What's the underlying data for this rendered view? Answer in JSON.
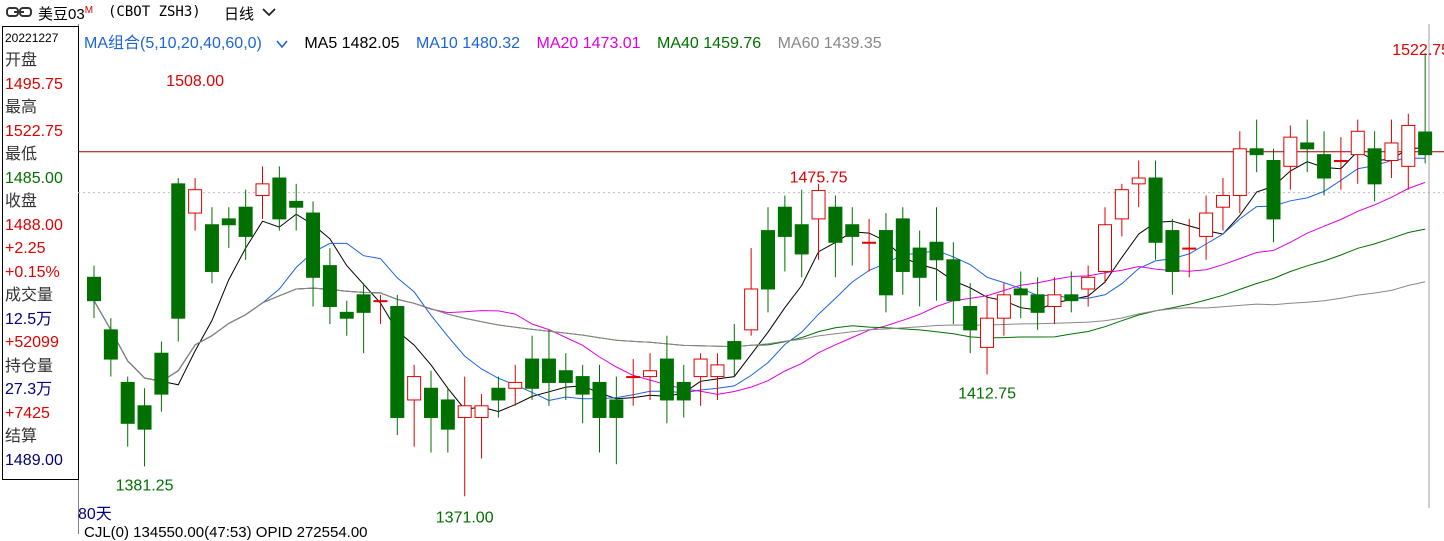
{
  "header": {
    "symbol": "美豆03",
    "symbol_mark": "M",
    "exchange": "(CBOT ZSH3)",
    "period": "日线",
    "link_icon": "link-icon",
    "chevron_icon": "chevron-down-icon"
  },
  "info_panel": {
    "date": "20221227",
    "open_label": "开盘",
    "open": "1495.75",
    "high_label": "最高",
    "high": "1522.75",
    "low_label": "最低",
    "low": "1485.00",
    "close_label": "收盘",
    "close": "1488.00",
    "change": "+2.25",
    "change_pct": "+0.15%",
    "volume_label": "成交量",
    "volume": "12.5万",
    "volume_change": "+52099",
    "oi_label": "持仓量",
    "oi": "27.3万",
    "oi_change": "+7425",
    "settle_label": "结算",
    "settle": "1489.00"
  },
  "legend": {
    "ma_combo": "MA组合(5,10,20,40,60,0)",
    "ma5": "MA5 1482.05",
    "ma10": "MA10 1480.32",
    "ma20": "MA20 1473.01",
    "ma40": "MA40 1459.76",
    "ma60": "MA60 1439.35"
  },
  "day_count": "80天",
  "bottom_text": "CJL(0)    134550.00(47:53)  OPID 272554.00",
  "colors": {
    "up": "#e00000",
    "down": "#007000",
    "ma5": "#000000",
    "ma10": "#1e64d8",
    "ma20": "#e000e0",
    "ma40": "#007000",
    "ma60": "#888888",
    "ref_line": "#a00000"
  },
  "chart_data": {
    "type": "candlestick",
    "y_range": [
      1367,
      1530
    ],
    "reference_price": 1489.0,
    "annotations": {
      "high_1508": "1508.00",
      "low_1381": "1381.25",
      "low_1371": "1371.00",
      "high_1475": "1475.75",
      "low_1412": "1412.75",
      "last_high": "1522.75"
    },
    "candles": [
      [
        1446,
        1438,
        1450,
        1432
      ],
      [
        1428,
        1418,
        1432,
        1412
      ],
      [
        1410,
        1396,
        1412,
        1388
      ],
      [
        1402,
        1394,
        1408,
        1381.25
      ],
      [
        1420,
        1406,
        1424,
        1400
      ],
      [
        1478,
        1432,
        1480,
        1424
      ],
      [
        1468,
        1476,
        1480,
        1462
      ],
      [
        1464,
        1448,
        1470,
        1444
      ],
      [
        1466,
        1464,
        1470,
        1456
      ],
      [
        1470,
        1460,
        1476,
        1452
      ],
      [
        1474,
        1478,
        1484,
        1466
      ],
      [
        1480,
        1466,
        1484,
        1462
      ],
      [
        1472,
        1470,
        1478,
        1462
      ],
      [
        1468,
        1446,
        1472,
        1436
      ],
      [
        1450,
        1436,
        1456,
        1430
      ],
      [
        1434,
        1432,
        1438,
        1426
      ],
      [
        1440,
        1434,
        1444,
        1420
      ],
      [
        1438,
        1438,
        1440,
        1430
      ],
      [
        1436,
        1398,
        1440,
        1392
      ],
      [
        1404,
        1412,
        1416,
        1388
      ],
      [
        1408,
        1398,
        1414,
        1386
      ],
      [
        1404,
        1394,
        1408,
        1386
      ],
      [
        1398,
        1402,
        1412,
        1371
      ],
      [
        1398,
        1402,
        1406,
        1384
      ],
      [
        1408,
        1404,
        1412,
        1398
      ],
      [
        1408,
        1410,
        1416,
        1402
      ],
      [
        1418,
        1408,
        1426,
        1404
      ],
      [
        1418,
        1410,
        1428,
        1402
      ],
      [
        1414,
        1410,
        1420,
        1404
      ],
      [
        1412,
        1406,
        1416,
        1396
      ],
      [
        1410,
        1398,
        1416,
        1386
      ],
      [
        1404,
        1398,
        1412,
        1382
      ],
      [
        1412,
        1412,
        1418,
        1402
      ],
      [
        1412,
        1414,
        1420,
        1404
      ],
      [
        1418,
        1404,
        1426,
        1396
      ],
      [
        1410,
        1404,
        1416,
        1398
      ],
      [
        1412,
        1418,
        1420,
        1402
      ],
      [
        1412,
        1416,
        1420,
        1404
      ],
      [
        1424,
        1418,
        1430,
        1412
      ],
      [
        1428,
        1442,
        1456,
        1426
      ],
      [
        1462,
        1442,
        1470,
        1434
      ],
      [
        1470,
        1460,
        1474,
        1448
      ],
      [
        1464,
        1454,
        1476,
        1446
      ],
      [
        1466,
        1475.75,
        1478,
        1452
      ],
      [
        1470,
        1458,
        1474,
        1446
      ],
      [
        1464,
        1460,
        1470,
        1450
      ],
      [
        1458,
        1458,
        1466,
        1448
      ],
      [
        1462,
        1440,
        1468,
        1434
      ],
      [
        1466,
        1448,
        1470,
        1440
      ],
      [
        1456,
        1446,
        1462,
        1436
      ],
      [
        1458,
        1452,
        1470,
        1438
      ],
      [
        1452,
        1438,
        1458,
        1430
      ],
      [
        1436,
        1428,
        1444,
        1420
      ],
      [
        1422,
        1432,
        1440,
        1412.75
      ],
      [
        1432,
        1440,
        1444,
        1426
      ],
      [
        1442,
        1440,
        1448,
        1432
      ],
      [
        1440,
        1434,
        1446,
        1428
      ],
      [
        1436,
        1440,
        1446,
        1430
      ],
      [
        1440,
        1438,
        1448,
        1434
      ],
      [
        1442,
        1446,
        1450,
        1436
      ],
      [
        1448,
        1464,
        1470,
        1444
      ],
      [
        1466,
        1476,
        1478,
        1460
      ],
      [
        1478,
        1480,
        1486,
        1470
      ],
      [
        1480,
        1458,
        1486,
        1452
      ],
      [
        1462,
        1448,
        1466,
        1440
      ],
      [
        1456,
        1456,
        1466,
        1446
      ],
      [
        1460,
        1468,
        1474,
        1452
      ],
      [
        1470,
        1474,
        1480,
        1462
      ],
      [
        1474,
        1490,
        1496,
        1468
      ],
      [
        1490,
        1488,
        1500,
        1482
      ],
      [
        1486,
        1466,
        1490,
        1458
      ],
      [
        1484,
        1494,
        1498,
        1476
      ],
      [
        1492,
        1490,
        1500,
        1482
      ],
      [
        1488,
        1480,
        1496,
        1474
      ],
      [
        1486,
        1486,
        1494,
        1476
      ],
      [
        1488,
        1496,
        1500,
        1478
      ],
      [
        1490,
        1478,
        1496,
        1472
      ],
      [
        1486,
        1492,
        1500,
        1480
      ],
      [
        1484,
        1498,
        1502,
        1476
      ],
      [
        1495.75,
        1488,
        1522.75,
        1485
      ]
    ]
  }
}
